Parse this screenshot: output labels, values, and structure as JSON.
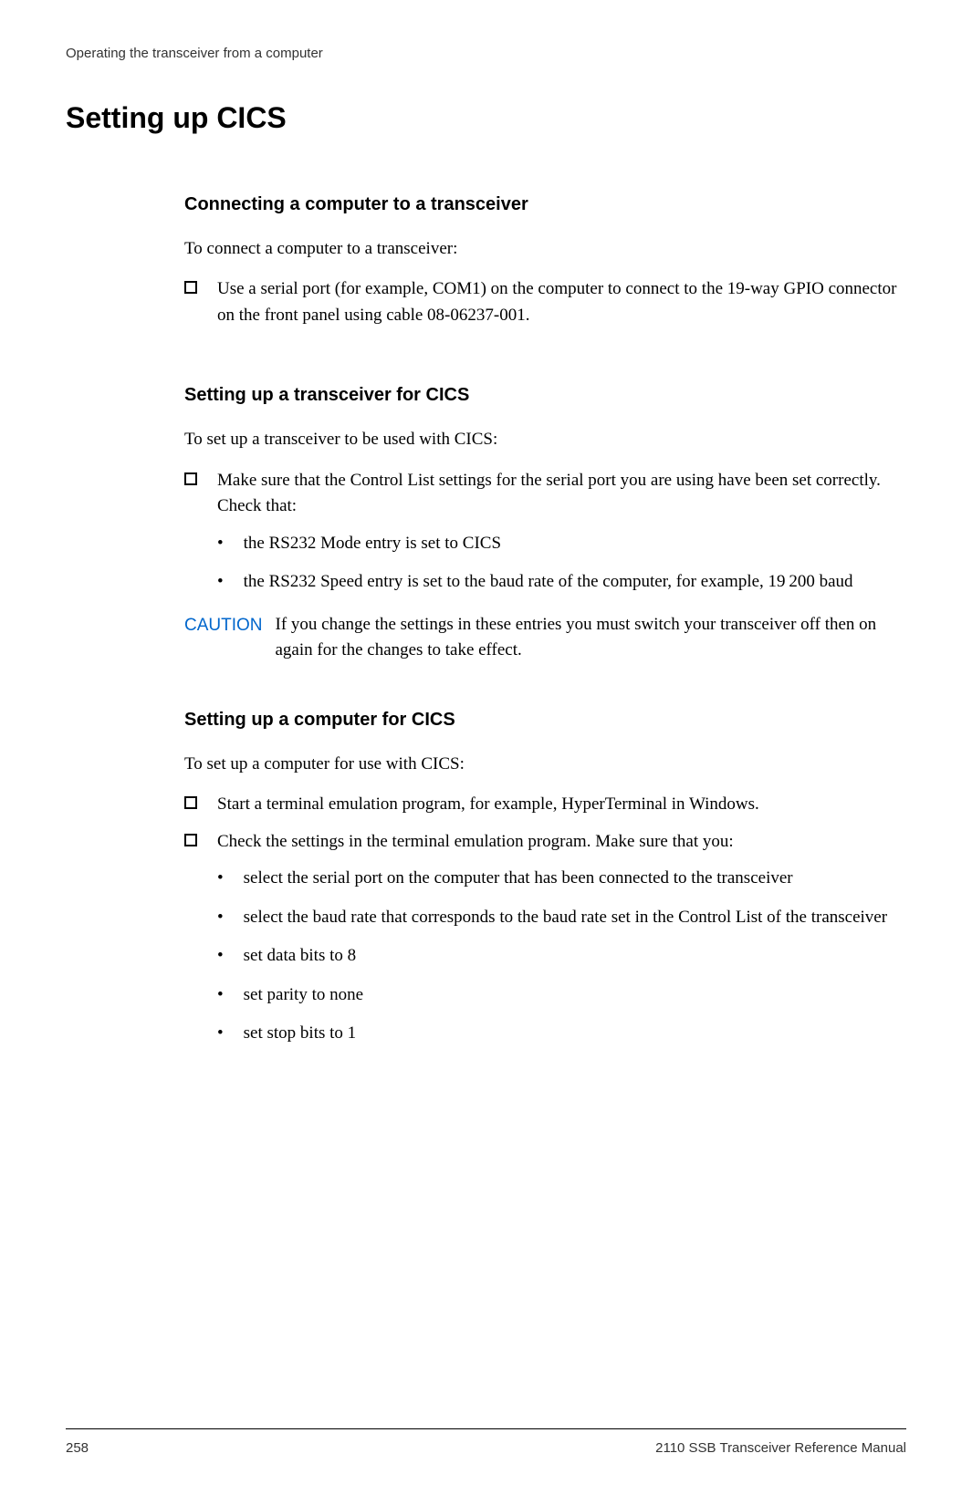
{
  "header": "Operating the transceiver from a computer",
  "title": "Setting up CICS",
  "section1": {
    "heading": "Connecting a computer to a transceiver",
    "intro": "To connect a computer to a transceiver:",
    "item1": "Use a serial port (for example, COM1) on the computer to connect to the 19-way GPIO connector on the front panel using cable 08-06237-001."
  },
  "section2": {
    "heading": "Setting up a transceiver for CICS",
    "intro": "To set up a transceiver to be used with CICS:",
    "item1": "Make sure that the Control List settings for the serial port you are using have been set correctly. Check that:",
    "bullet1": "the RS232 Mode entry is set to CICS",
    "bullet2": "the RS232 Speed entry is set to the baud rate of the computer, for example, 19 200 baud",
    "caution_label": "CAUTION",
    "caution_text": "If you change the settings in these entries you must switch your transceiver off then on again for the changes to take effect."
  },
  "section3": {
    "heading": "Setting up a computer for CICS",
    "intro": "To set up a computer for use with CICS:",
    "item1": "Start a terminal emulation program, for example, HyperTerminal in Windows.",
    "item2": "Check the settings in the terminal emulation program. Make sure that you:",
    "bullet1": "select the serial port on the computer that has been connected to the transceiver",
    "bullet2": "select the baud rate that corresponds to the baud rate set in the Control List of the transceiver",
    "bullet3": "set data bits to 8",
    "bullet4": "set parity to none",
    "bullet5": "set stop bits to 1"
  },
  "footer": {
    "page": "258",
    "docname": "2110 SSB Transceiver Reference Manual"
  }
}
